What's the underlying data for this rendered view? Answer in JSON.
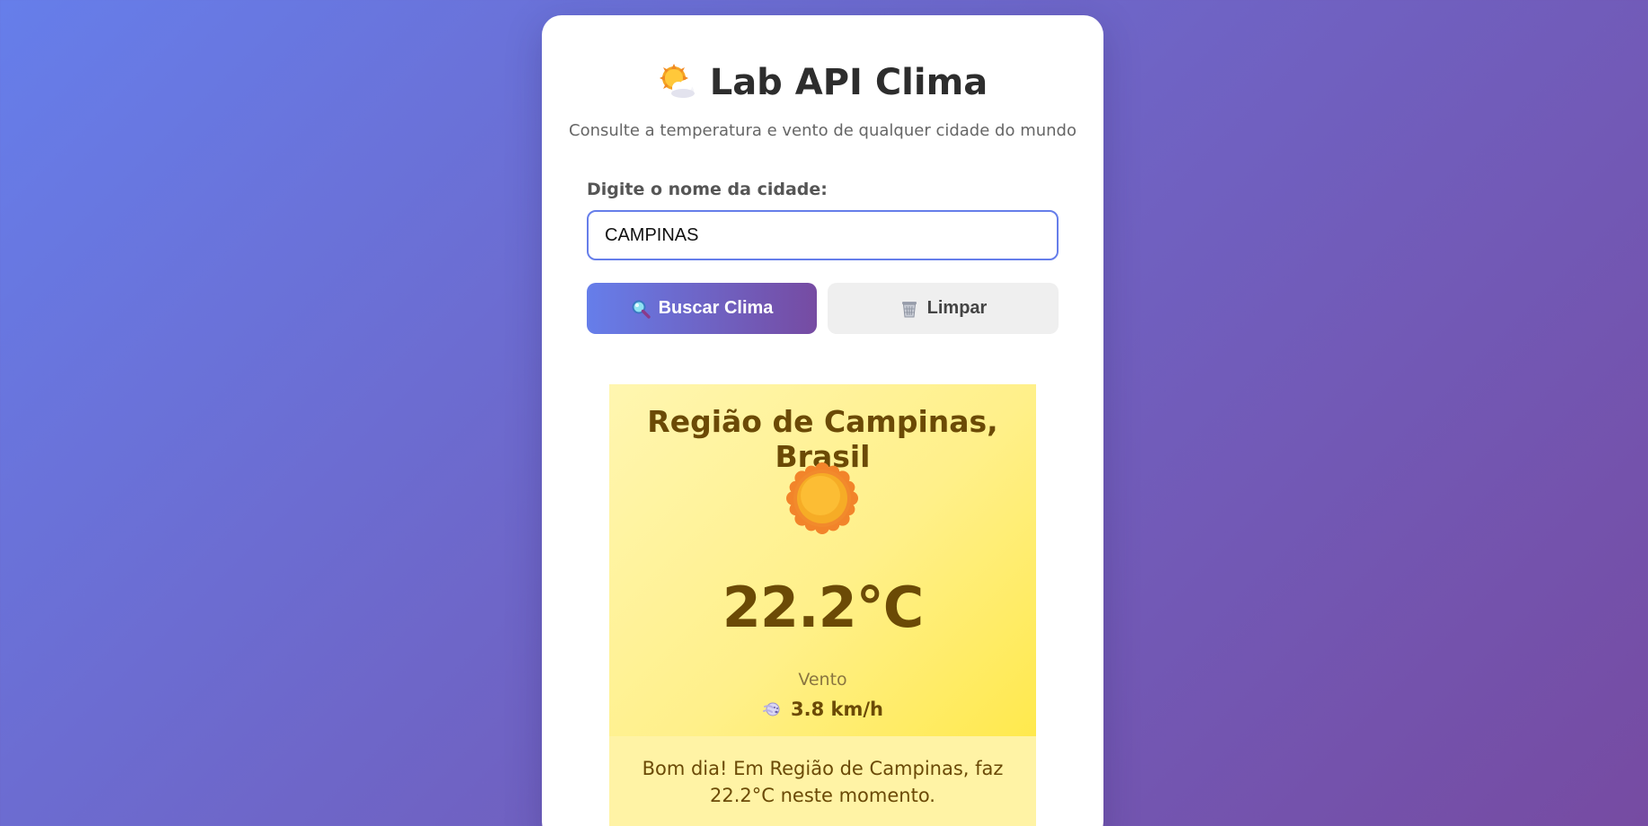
{
  "header": {
    "title": "Lab API Clima",
    "title_icon": "sun-behind-cloud-icon",
    "subtitle": "Consulte a temperatura e vento de qualquer cidade do mundo"
  },
  "search": {
    "label": "Digite o nome da cidade:",
    "value": "CAMPINAS",
    "placeholder": ""
  },
  "buttons": {
    "search_label": "Buscar Clima",
    "search_icon": "magnifying-glass-icon",
    "clear_label": "Limpar",
    "clear_icon": "wastebasket-icon"
  },
  "result": {
    "location": "Região de Campinas, Brasil",
    "condition_icon": "sun-icon",
    "temperature": "22.2°C",
    "wind_label": "Vento",
    "wind_icon": "wind-face-icon",
    "wind_value": "3.8 km/h",
    "message": "Bom dia! Em Região de Campinas, faz 22.2°C neste momento."
  },
  "colors": {
    "accent_start": "#667eea",
    "accent_end": "#764ba2",
    "result_bg": "#fff08a",
    "result_text": "#6b4a06"
  }
}
